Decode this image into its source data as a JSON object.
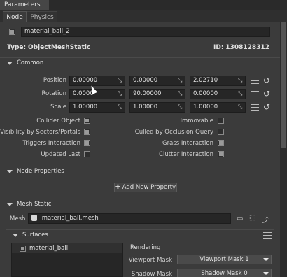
{
  "panel": {
    "title": "Parameters"
  },
  "tabs": [
    {
      "label": "Node"
    },
    {
      "label": "Physics"
    }
  ],
  "node": {
    "name": "material_ball_2",
    "type_label": "Type:",
    "type_value": "ObjectMeshStatic",
    "id_label": "ID:",
    "id_value": "1308128312"
  },
  "common": {
    "title": "Common",
    "position_label": "Position",
    "position": [
      "0.00000",
      "0.00000",
      "2.02710"
    ],
    "rotation_label": "Rotation",
    "rotation": [
      "0.0000",
      "90.00000",
      "0.00000"
    ],
    "scale_label": "Scale",
    "scale": [
      "1.00000",
      "1.00000",
      "1.00000"
    ],
    "collider_object": "Collider Object",
    "immovable": "Immovable",
    "visibility_by_sectors": "Visibility by Sectors/Portals",
    "culled_by_occlusion": "Culled by Occlusion Query",
    "triggers_interaction": "Triggers Interaction",
    "grass_interaction": "Grass Interaction",
    "updated_last": "Updated Last",
    "clutter_interaction": "Clutter Interaction"
  },
  "node_properties": {
    "title": "Node Properties",
    "add_button": "Add New Property"
  },
  "mesh_static": {
    "title": "Mesh Static",
    "mesh_label": "Mesh",
    "mesh_value": "material_ball.mesh"
  },
  "surfaces": {
    "title": "Surfaces",
    "items": [
      {
        "label": "material_ball"
      }
    ],
    "rendering_title": "Rendering",
    "viewport_mask_label": "Viewport Mask",
    "viewport_mask_value": "Viewport Mask 1",
    "shadow_mask_label": "Shadow Mask",
    "shadow_mask_value": "Shadow Mask 0"
  }
}
